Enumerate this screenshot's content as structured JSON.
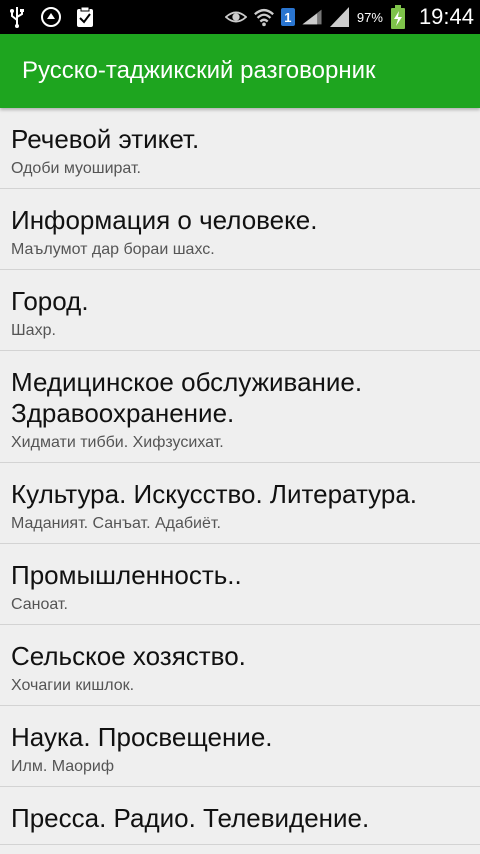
{
  "status_bar": {
    "icons": [
      "usb-icon",
      "sync-icon",
      "clipboard-icon",
      "eye-icon",
      "wifi-icon",
      "signal-icon",
      "battery-icon"
    ],
    "sim_number": "1",
    "battery_percent": "97%",
    "time": "19:44"
  },
  "app_bar": {
    "title": "Русско-таджикский разговорник",
    "color": "#1ea51f"
  },
  "list": {
    "items": [
      {
        "title": "Речевой этикет.",
        "subtitle": "Одоби муошират."
      },
      {
        "title": "Информация о человеке.",
        "subtitle": "Маълумот дар бораи шахс."
      },
      {
        "title": "Город.",
        "subtitle": "Шахр."
      },
      {
        "title": "Медицинское обслуживание.\nЗдравоохранение.",
        "subtitle": "Хидмати тибби. Хифзусихат."
      },
      {
        "title": "Культура. Искусство. Литература.",
        "subtitle": "Маданият. Санъат. Адабиёт."
      },
      {
        "title": "Промышленность..",
        "subtitle": "Саноат."
      },
      {
        "title": "Сельское хозяство.",
        "subtitle": "Хочагии кишлок."
      },
      {
        "title": "Наука. Просвещение.",
        "subtitle": "Илм. Маориф"
      },
      {
        "title": "Пресса. Радио. Телевидение.",
        "subtitle": ""
      }
    ]
  }
}
